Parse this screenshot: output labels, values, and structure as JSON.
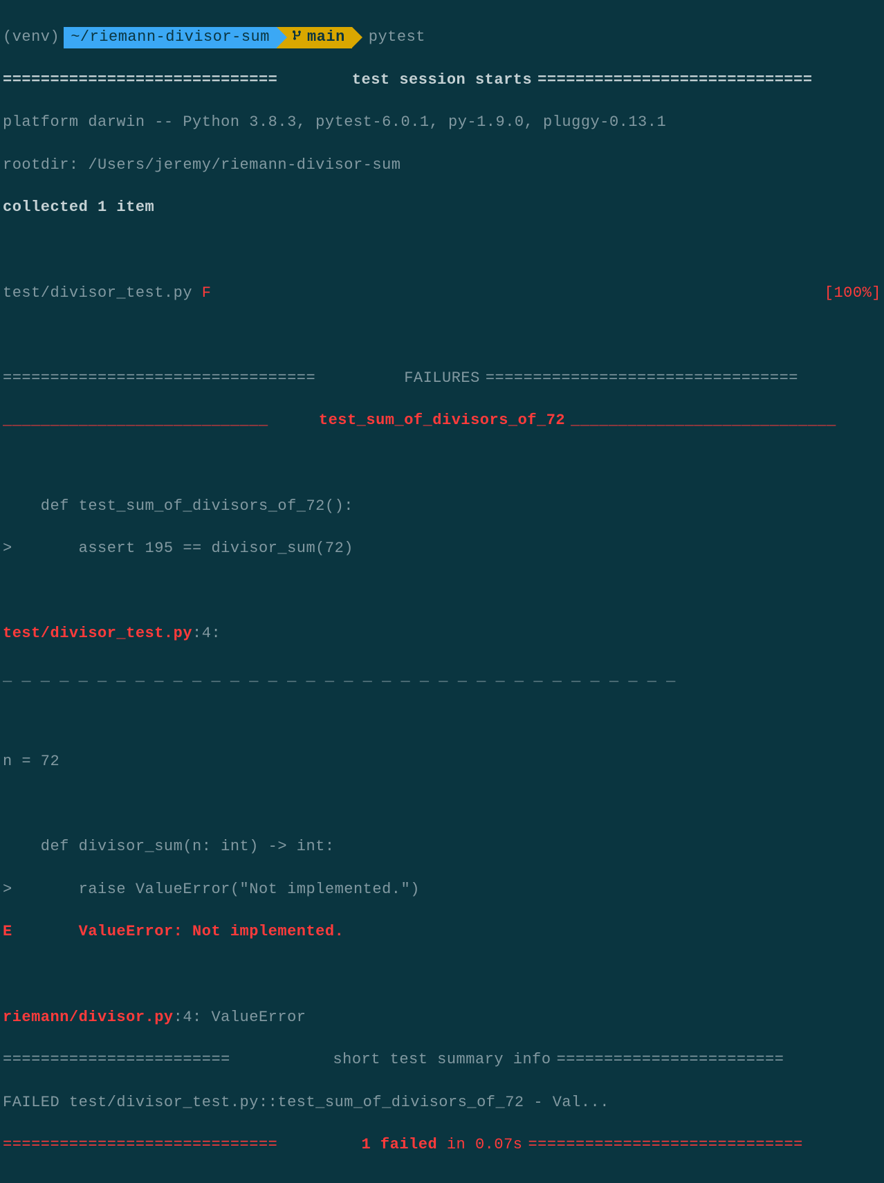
{
  "prompt": {
    "venv": "(venv)",
    "path": "~/riemann-divisor-sum",
    "branch": "main",
    "command": "pytest"
  },
  "session_header": {
    "label": "test session starts",
    "eq_fill": "============================="
  },
  "platform_line": "platform darwin -- Python 3.8.3, pytest-6.0.1, py-1.9.0, pluggy-0.13.1",
  "rootdir_line": "rootdir: /Users/jeremy/riemann-divisor-sum",
  "collected_line": "collected 1 item",
  "test_file_line": {
    "path": "test/divisor_test.py ",
    "mark": "F",
    "progress": "[100%]"
  },
  "failures_header": {
    "label": "FAILURES",
    "eq_fill": "================================="
  },
  "test_name_header": {
    "name": "test_sum_of_divisors_of_72",
    "underscore_fill": "____________________________"
  },
  "code_block_1": {
    "l1": "    def test_sum_of_divisors_of_72():",
    "l2": ">       assert 195 == divisor_sum(72)"
  },
  "file_ref_1": {
    "path": "test/divisor_test.py",
    "suffix": ":4:"
  },
  "dash_sep": "_ _ _ _ _ _ _ _ _ _ _ _ _ _ _ _ _ _ _ _ _ _ _ _ _ _ _ _ _ _ _ _ _ _ _ _",
  "code_block_2": {
    "l1": "n = 72",
    "l2": "    def divisor_sum(n: int) -> int:",
    "l3": ">       raise ValueError(\"Not implemented.\")",
    "l4_prefix": "E       ",
    "l4_msg": "ValueError: Not implemented."
  },
  "file_ref_2": {
    "path": "riemann/divisor.py",
    "suffix": ":4: ValueError"
  },
  "summary_header": {
    "label": "short test summary info",
    "eq_fill": "========================"
  },
  "summary_line": "FAILED test/divisor_test.py::test_sum_of_divisors_of_72 - Val...",
  "final_line": {
    "fail": "1 failed",
    "in": " in 0.07s ",
    "eq_fill": "============================="
  }
}
